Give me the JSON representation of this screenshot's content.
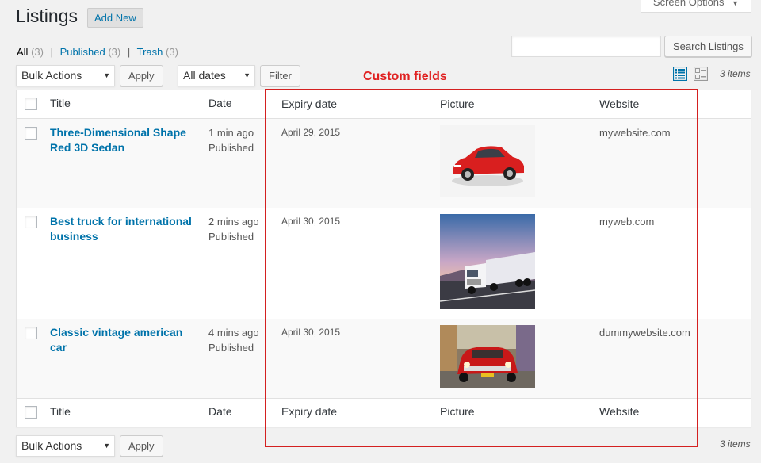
{
  "header": {
    "title": "Listings",
    "add_new": "Add New",
    "screen_options": "Screen Options"
  },
  "filters": {
    "all": {
      "label": "All",
      "count": "(3)"
    },
    "published": {
      "label": "Published",
      "count": "(3)"
    },
    "trash": {
      "label": "Trash",
      "count": "(3)"
    },
    "sep": "|"
  },
  "search": {
    "button": "Search Listings",
    "value": ""
  },
  "actions": {
    "bulk": "Bulk Actions",
    "apply": "Apply",
    "dates": "All dates",
    "filter": "Filter",
    "items": "3 items"
  },
  "annotation": {
    "label": "Custom fields",
    "color": "#d42020"
  },
  "columns": {
    "title": "Title",
    "date": "Date",
    "expiry": "Expiry date",
    "picture": "Picture",
    "website": "Website"
  },
  "rows": [
    {
      "title": "Three-Dimensional Shape Red 3D Sedan",
      "date": "1 min ago",
      "status": "Published",
      "expiry": "April 29, 2015",
      "picture": "red-sedan-image",
      "website": "mywebsite.com"
    },
    {
      "title": "Best truck for international business",
      "date": "2 mins ago",
      "status": "Published",
      "expiry": "April 30, 2015",
      "picture": "white-truck-image",
      "website": "myweb.com"
    },
    {
      "title": "Classic vintage american car",
      "date": "4 mins ago",
      "status": "Published",
      "expiry": "April 30, 2015",
      "picture": "vintage-red-car-image",
      "website": "dummywebsite.com"
    }
  ],
  "colors": {
    "link": "#0073aa",
    "background": "#f1f1f1"
  }
}
